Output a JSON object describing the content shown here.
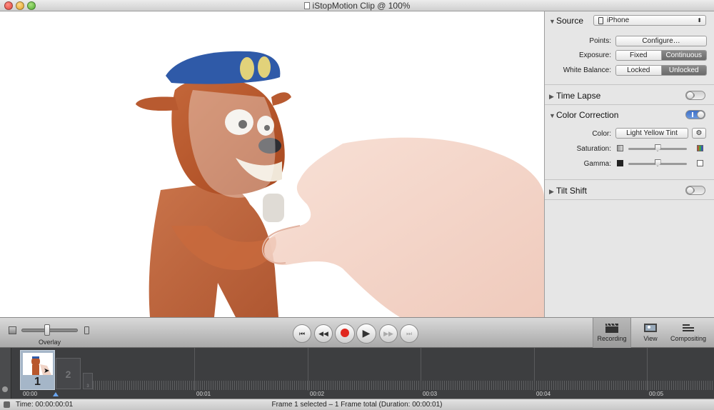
{
  "window": {
    "title": "iStopMotion Clip @ 100%"
  },
  "inspector": {
    "source": {
      "heading": "Source",
      "device": "iPhone",
      "points_label": "Points:",
      "points_button": "Configure…",
      "exposure_label": "Exposure:",
      "exposure_options": [
        "Fixed",
        "Continuous"
      ],
      "exposure_selected": "Continuous",
      "white_balance_label": "White Balance:",
      "white_balance_options": [
        "Locked",
        "Unlocked"
      ],
      "white_balance_selected": "Unlocked"
    },
    "time_lapse": {
      "heading": "Time Lapse",
      "enabled": false
    },
    "color_correction": {
      "heading": "Color Correction",
      "enabled": true,
      "color_label": "Color:",
      "color_value": "Light Yellow Tint",
      "saturation_label": "Saturation:",
      "saturation_value": 0.5,
      "gamma_label": "Gamma:",
      "gamma_value": 0.5
    },
    "tilt_shift": {
      "heading": "Tilt Shift",
      "enabled": false
    }
  },
  "controls": {
    "overlay_label": "Overlay",
    "overlay_value": 0.45,
    "playback_buttons": [
      "skip-to-start",
      "step-back",
      "record",
      "play",
      "step-forward",
      "skip-to-end"
    ],
    "tools": {
      "recording": "Recording",
      "view": "View",
      "compositing": "Compositing"
    },
    "active_tool": "Recording"
  },
  "timeline": {
    "time_labels": [
      "00:00",
      "00:01",
      "00:02",
      "00:03",
      "00:04",
      "00:05"
    ],
    "frames": [
      {
        "number": "1",
        "selected": true
      },
      {
        "number": "2",
        "selected": false
      },
      {
        "number": "3",
        "selected": false
      }
    ]
  },
  "status": {
    "time": "Time: 00:00:00:01",
    "selection": "Frame 1 selected – 1 Frame total (Duration: 00:00:01)"
  },
  "colors": {
    "record": "#e0271e",
    "toggle_on": "#4a7bd0",
    "timeline_bg": "#3d3e40"
  }
}
